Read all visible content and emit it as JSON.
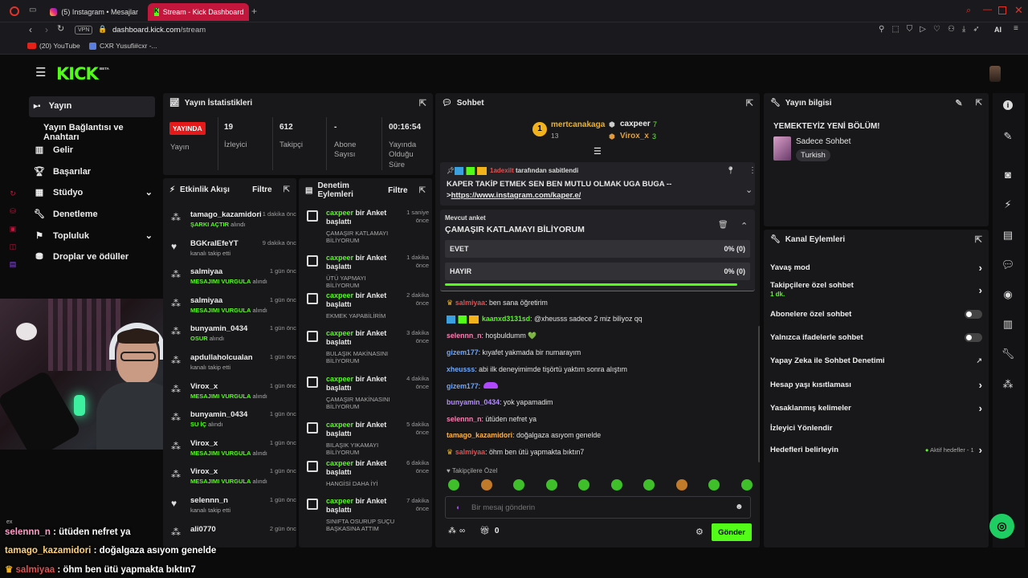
{
  "browser": {
    "tabs": [
      {
        "title": "(5) Instagram • Mesajlar"
      },
      {
        "title": "Stream - Kick Dashboard"
      }
    ],
    "url_host": "dashboard.kick.com",
    "url_path": "/stream",
    "vpn_label": "VPN",
    "bookmarks": [
      "(20) YouTube",
      "CXR Yusufi#cxr -..."
    ],
    "ai_label": "AI"
  },
  "kick": {
    "logo": "KICK",
    "beta": "BETA"
  },
  "sidebar": {
    "items": [
      {
        "label": "Yayın",
        "icon": "video-icon"
      },
      {
        "label": "Yayın Bağlantısı ve Anahtarı"
      },
      {
        "label": "Gelir",
        "icon": "chart-icon"
      },
      {
        "label": "Başarılar",
        "icon": "trophy-icon"
      },
      {
        "label": "Stüdyo",
        "icon": "studio-icon"
      },
      {
        "label": "Denetleme",
        "icon": "wrench-icon"
      },
      {
        "label": "Topluluk",
        "icon": "community-icon"
      },
      {
        "label": "Droplar ve ödüller",
        "icon": "drops-icon"
      }
    ]
  },
  "stats": {
    "title": "Yayın İstatistikleri",
    "live_badge": "YAYINDA",
    "live_label": "Yayın",
    "viewers_value": "19",
    "viewers_label": "İzleyici",
    "followers_value": "612",
    "followers_label": "Takipçi",
    "subs_value": "-",
    "subs_label": "Abone Sayısı",
    "uptime_value": "00:16:54",
    "uptime_label": "Yayında Olduğu Süre"
  },
  "activity": {
    "title": "Etkinlik Akışı",
    "filter": "Filtre",
    "items": [
      {
        "name": "tamago_kazamidori",
        "sub_b": "ŞARKI AÇTIR",
        "sub": " alındı",
        "time": "1 dakika önce"
      },
      {
        "name": "BGKralEfeYT",
        "sub_b": "",
        "sub": "kanalı takip etti",
        "time": "9 dakika önce"
      },
      {
        "name": "salmiyaa",
        "sub_b": "MESAJIMI VURGULA",
        "sub": " alındı",
        "time": "1 gün önce"
      },
      {
        "name": "salmiyaa",
        "sub_b": "MESAJIMI VURGULA",
        "sub": " alındı",
        "time": "1 gün önce"
      },
      {
        "name": "bunyamin_0434",
        "sub_b": "OSUR",
        "sub": " alındı",
        "time": "1 gün önce"
      },
      {
        "name": "apdullaholcualan",
        "sub_b": "",
        "sub": "kanalı takip etti",
        "time": "1 gün önce"
      },
      {
        "name": "Virox_x",
        "sub_b": "MESAJIMI VURGULA",
        "sub": " alındı",
        "time": "1 gün önce"
      },
      {
        "name": "bunyamin_0434",
        "sub_b": "SU İÇ",
        "sub": " alındı",
        "time": "1 gün önce"
      },
      {
        "name": "Virox_x",
        "sub_b": "MESAJIMI VURGULA",
        "sub": " alındı",
        "time": "1 gün önce"
      },
      {
        "name": "Virox_x",
        "sub_b": "MESAJIMI VURGULA",
        "sub": " alındı",
        "time": "1 gün önce"
      },
      {
        "name": "selennn_n",
        "sub_b": "",
        "sub": "kanalı takip etti",
        "time": "1 gün önce"
      },
      {
        "name": "ali0770",
        "sub_b": "",
        "sub": "",
        "time": "2 gün önce"
      }
    ]
  },
  "moderation": {
    "title": "Denetim Eylemleri",
    "filter": "Filtre",
    "items": [
      {
        "user": "caxpeer",
        "action": " bir Anket başlattı",
        "sub": "ÇAMAŞIR KATLAMAYI BİLİYORUM",
        "time": "1 saniye önce"
      },
      {
        "user": "caxpeer",
        "action": " bir Anket başlattı",
        "sub": "ÜTÜ YAPMAYI BİLİYORUM",
        "time": "1 dakika önce"
      },
      {
        "user": "caxpeer",
        "action": " bir Anket başlattı",
        "sub": "EKMEK YAPABİLİRİM",
        "time": "2 dakika önce"
      },
      {
        "user": "caxpeer",
        "action": " bir Anket başlattı",
        "sub": "BULAŞIK MAKİNASINI BİLİYORUM",
        "time": "3 dakika önce"
      },
      {
        "user": "caxpeer",
        "action": " bir Anket başlattı",
        "sub": "ÇAMAŞIR MAKİNASINI BİLİYORUM",
        "time": "4 dakika önce"
      },
      {
        "user": "caxpeer",
        "action": " bir Anket başlattı",
        "sub": "BILAŞIK YIKAMAYI BİLİYORUM",
        "time": "5 dakika önce"
      },
      {
        "user": "caxpeer",
        "action": " bir Anket başlattı",
        "sub": "HANGİSİ DAHA İYİ",
        "time": "6 dakika önce"
      },
      {
        "user": "caxpeer",
        "action": " bir Anket başlattı",
        "sub": "SINIFTA OSURUP SUÇU BAŞKASINA ATTIM",
        "time": "7 dakika önce"
      }
    ]
  },
  "chat": {
    "title": "Sohbet",
    "leaders": [
      {
        "name": "mertcanakaga",
        "count": "13"
      },
      {
        "name": "caxpeer",
        "count": "7"
      },
      {
        "name": "Virox_x",
        "count": "3"
      }
    ],
    "pinned_by": "1adexilt",
    "pinned_suffix": " tarafından sabitlendi",
    "pinned_text": "KAPER TAKİP ETMEK SEN BEN MUTLU OLMAK UGA BUGA --",
    "pinned_link_prefix": ">",
    "pinned_link": "https://www.instagram.com/kaper.e/",
    "poll_label": "Mevcut anket",
    "poll_title": "ÇAMAŞIR KATLAMAYI BİLİYORUM",
    "poll_options": [
      {
        "label": "EVET",
        "result": "0% (0)"
      },
      {
        "label": "HAYIR",
        "result": "0% (0)"
      }
    ],
    "messages": [
      {
        "user": "salmiyaa",
        "text": ": ben sana öğretirim",
        "color": "#e05050"
      },
      {
        "user": "kaanxd3131sd",
        "text": ": @xheusss sadece 2 miz biliyoz qq",
        "color": "#53fc18"
      },
      {
        "user": "selennn_n",
        "text": ": hoşbuldumm 💚",
        "color": "#ff7eb3"
      },
      {
        "user": "gizem177",
        "text": ": kıyafet yakmada bir numarayım",
        "color": "#6ea8ff"
      },
      {
        "user": "xheusss",
        "text": ": abi ilk deneyimimde tişörtü yaktım sonra alıştım",
        "color": "#6ea8ff"
      },
      {
        "user": "gizem177",
        "text": ":",
        "color": "#6ea8ff"
      },
      {
        "user": "bunyamin_0434",
        "text": ": yok yapamadim",
        "color": "#b48cff"
      },
      {
        "user": "selennn_n",
        "text": ": ütüden nefret ya",
        "color": "#ff7eb3"
      },
      {
        "user": "tamago_kazamidori",
        "text": ": doğalgaza asıyom genelde",
        "color": "#ffb347"
      },
      {
        "user": "salmiyaa",
        "text": ": öhm ben ütü yapmakta bıktın7",
        "color": "#e05050"
      }
    ],
    "followers_only": "Takipçilere Özel",
    "input_placeholder": "Bir mesaj gönderin",
    "points": "0",
    "infinite": "∞",
    "send": "Gönder"
  },
  "info": {
    "title": "Yayın bilgisi",
    "stream_title": "YEMEKTEYİZ YENİ BÖLÜM!",
    "category": "Sadece Sohbet",
    "language": "Turkish"
  },
  "channel_actions": {
    "title": "Kanal Eylemleri",
    "slow_mode": "Yavaş mod",
    "followers_chat": "Takipçilere özel sohbet",
    "followers_chat_sub": "1 dk.",
    "subs_chat": "Abonelere özel sohbet",
    "emotes_chat": "Yalnızca ifadelerle sohbet",
    "ai_mod": "Yapay Zeka ile Sohbet Denetimi",
    "account_age": "Hesap yaşı kısıtlaması",
    "banned_words": "Yasaklanmış kelimeler",
    "viewer_redirect": "İzleyici Yönlendir",
    "goals": "Hedefleri belirleyin",
    "goals_status": "Aktif hedefler - 1"
  },
  "overlay": {
    "lines": [
      {
        "user": "selennn_n",
        "text": " : ütüden nefret ya"
      },
      {
        "user": "tamago_kazamidori",
        "text": " : doğalgaza asıyom genelde"
      },
      {
        "user": "salmiyaa",
        "text": " : öhm ben ütü yapmakta bıktın7"
      }
    ],
    "small_tag": "ex"
  },
  "colors": {
    "accent": "#53fc18",
    "live": "#e51919",
    "panel": "#18181b",
    "background": "#0b0b0c"
  }
}
